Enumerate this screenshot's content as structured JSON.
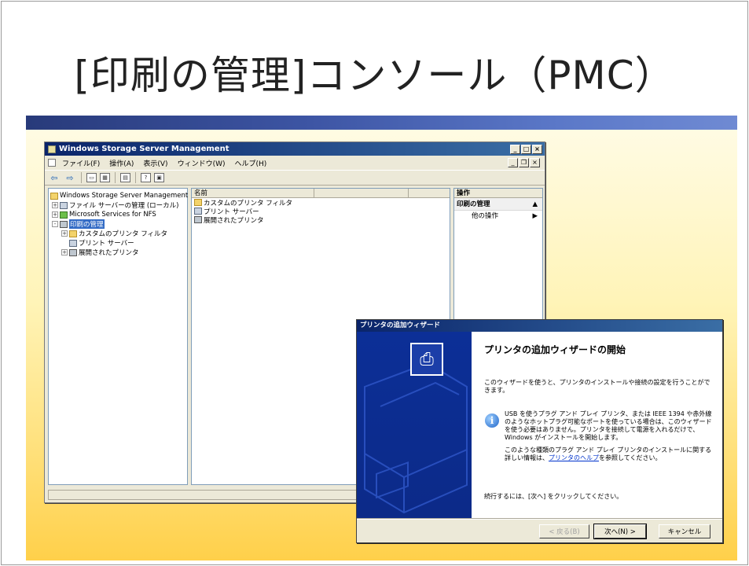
{
  "slide": {
    "title": "[印刷の管理]コンソール（PMC）"
  },
  "mmc": {
    "window_title": "Windows Storage Server Management",
    "menu": [
      "ファイル(F)",
      "操作(A)",
      "表示(V)",
      "ウィンドウ(W)",
      "ヘルプ(H)"
    ],
    "toolbar_icons": [
      "back-arrow-icon",
      "forward-arrow-icon",
      "up-folder-icon",
      "show-hide-tree-icon",
      "export-list-icon",
      "help-icon",
      "properties-icon"
    ],
    "tree": [
      {
        "label": "Windows Storage Server Management",
        "level": 0,
        "expander": "",
        "icon": "folder"
      },
      {
        "label": "ファイル サーバーの管理 (ローカル)",
        "level": 1,
        "expander": "+",
        "icon": "server"
      },
      {
        "label": "Microsoft Services for NFS",
        "level": 1,
        "expander": "+",
        "icon": "green"
      },
      {
        "label": "印刷の管理",
        "level": 1,
        "expander": "-",
        "icon": "printer",
        "selected": true
      },
      {
        "label": "カスタムのプリンタ フィルタ",
        "level": 2,
        "expander": "+",
        "icon": "folder"
      },
      {
        "label": "プリント サーバー",
        "level": 2,
        "expander": "",
        "icon": "server"
      },
      {
        "label": "展開されたプリンタ",
        "level": 2,
        "expander": "+",
        "icon": "printer"
      }
    ],
    "list": {
      "column_name": "名前",
      "rows": [
        "カスタムのプリンタ フィルタ",
        "プリント サーバー",
        "展開されたプリンタ"
      ]
    },
    "actions": {
      "header": "操作",
      "section": "印刷の管理",
      "item": "他の操作"
    }
  },
  "wizard": {
    "title": "プリンタの追加ウィザード",
    "heading": "プリンタの追加ウィザードの開始",
    "intro": "このウィザードを使うと、プリンタのインストールや接続の設定を行うことができます。",
    "info_text": "USB を使うプラグ アンド プレイ プリンタ、または IEEE 1394 や赤外線のようなホットプラグ可能なポートを使っている場合は、このウィザードを使う必要はありません。プリンタを接続して電源を入れるだけで、Windows がインストールを開始します。",
    "more_info_prefix": "このような種類のプラグ アンド プレイ プリンタのインストールに関する詳しい情報は、",
    "more_info_link": "プリンタのヘルプ",
    "more_info_suffix": "を参照してください。",
    "continue_text": "続行するには、[次へ] をクリックしてください。",
    "buttons": {
      "back": "< 戻る(B)",
      "next": "次へ(N) >",
      "cancel": "キャンセル"
    }
  }
}
